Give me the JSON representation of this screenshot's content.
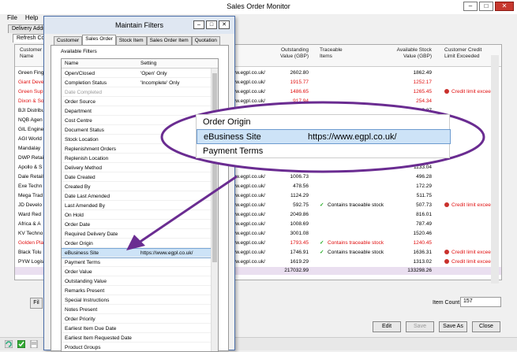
{
  "main": {
    "title": "Sales Order Monitor",
    "menu": [
      "File",
      "Help"
    ],
    "tabs": [
      "Delivery Addre"
    ],
    "subtab": "Refresh Cor",
    "columns": {
      "customer_name": "Customer\nName",
      "outstanding_value": "Outstanding\nValue (GBP)",
      "traceable_items": "Traceable\nItems",
      "available_stock_value": "Available Stock\nValue (GBP)",
      "customer_credit_limit": "Customer Credit\nLimit Exceeded"
    },
    "rows": [
      {
        "name": "Green Fing",
        "red": false,
        "site": "www.egpl.co.uk/",
        "outstanding": "2602.80",
        "traceable": "",
        "available": "1862.49",
        "credit": ""
      },
      {
        "name": "Giant Deve",
        "red": true,
        "site": "www.egpl.co.uk/",
        "outstanding": "1915.77",
        "traceable": "",
        "available": "1252.17",
        "credit": ""
      },
      {
        "name": "Green Sup",
        "red": true,
        "site": "www.egpl.co.uk/",
        "outstanding": "1486.65",
        "traceable": "",
        "available": "1265.45",
        "credit": "Credit limit exceede"
      },
      {
        "name": "Dixon & So",
        "red": true,
        "site": "www.egpl.co.uk/",
        "outstanding": "917.94",
        "traceable": "",
        "available": "254.34",
        "credit": ""
      },
      {
        "name": "BJI Distribu",
        "red": false,
        "site": "",
        "outstanding": "",
        "traceable": "",
        "available": "899.37",
        "credit": ""
      },
      {
        "name": "NQB Agen",
        "red": false,
        "site": "",
        "outstanding": "",
        "traceable": "",
        "available": "",
        "credit": ""
      },
      {
        "name": "GIL Engine",
        "red": false,
        "site": "",
        "outstanding": "",
        "traceable": "",
        "available": "",
        "credit": ""
      },
      {
        "name": "AGI World",
        "red": false,
        "site": "",
        "outstanding": "",
        "traceable": "",
        "available": "",
        "credit": ""
      },
      {
        "name": "Mandalay",
        "red": false,
        "site": "",
        "outstanding": "",
        "traceable": "",
        "available": "",
        "credit": ""
      },
      {
        "name": "DWP Retai",
        "red": false,
        "site": "",
        "outstanding": "",
        "traceable": "",
        "available": "",
        "credit": ""
      },
      {
        "name": "Apollo & S",
        "red": false,
        "site": "",
        "outstanding": "",
        "traceable": "",
        "available": "1133.04",
        "credit": ""
      },
      {
        "name": "Dale Retail",
        "red": false,
        "site": "www.egpl.co.uk/",
        "outstanding": "1006.73",
        "traceable": "",
        "available": "496.28",
        "credit": ""
      },
      {
        "name": "Exe Techn",
        "red": false,
        "site": "www.egpl.co.uk/",
        "outstanding": "478.56",
        "traceable": "",
        "available": "172.29",
        "credit": ""
      },
      {
        "name": "Mega Trad",
        "red": false,
        "site": "www.egpl.co.uk/",
        "outstanding": "1124.29",
        "traceable": "",
        "available": "511.75",
        "credit": ""
      },
      {
        "name": "JD Develo",
        "red": false,
        "site": "www.egpl.co.uk/",
        "outstanding": "592.75",
        "traceable": "Contains traceable stock",
        "available": "507.73",
        "credit": "Credit limit exceede"
      },
      {
        "name": "Ward Red",
        "red": false,
        "site": "www.egpl.co.uk/",
        "outstanding": "2049.86",
        "traceable": "",
        "available": "816.01",
        "credit": ""
      },
      {
        "name": "Africa & A",
        "red": false,
        "site": "www.egpl.co.uk/",
        "outstanding": "1008.69",
        "traceable": "",
        "available": "787.49",
        "credit": ""
      },
      {
        "name": "KV Techno",
        "red": false,
        "site": "www.egpl.co.uk/",
        "outstanding": "3001.08",
        "traceable": "",
        "available": "1520.46",
        "credit": ""
      },
      {
        "name": "Golden Pla",
        "red": true,
        "site": "www.egpl.co.uk/",
        "outstanding": "1793.45",
        "traceable": "Contains traceable stock",
        "available": "1240.45",
        "credit": ""
      },
      {
        "name": "Black Tolu",
        "red": false,
        "site": "www.egpl.co.uk/",
        "outstanding": "1746.91",
        "traceable": "Contains traceable stock",
        "available": "1636.31",
        "credit": "Credit limit exceede"
      },
      {
        "name": "PYW Logis",
        "red": false,
        "site": "www.egpl.co.uk/",
        "outstanding": "1619.29",
        "traceable": "",
        "available": "1313.02",
        "credit": "Credit limit exceede"
      }
    ],
    "totals": {
      "outstanding": "217032.99",
      "available": "133298.26"
    },
    "item_count_label": "Item Count",
    "item_count_value": "157",
    "filter_button": "Fil",
    "buttons": {
      "edit": "Edit",
      "save": "Save",
      "save_as": "Save As",
      "close": "Close"
    }
  },
  "dialog": {
    "title": "Maintain Filters",
    "tabs": [
      "Customer",
      "Sales Order",
      "Stock Item",
      "Sales Order Item",
      "Quotation"
    ],
    "active_tab": "Sales Order",
    "available_filters_label": "Available Filters",
    "col_name": "Name",
    "col_setting": "Setting",
    "filters": [
      {
        "name": "Open/Closed",
        "setting": "'Open' Only",
        "disabled": false
      },
      {
        "name": "Completion Status",
        "setting": "'Incomplete' Only",
        "disabled": false
      },
      {
        "name": "Date Completed",
        "setting": "",
        "disabled": true
      },
      {
        "name": "Order Source",
        "setting": "",
        "disabled": false
      },
      {
        "name": "Department",
        "setting": "",
        "disabled": false
      },
      {
        "name": "Cost Centre",
        "setting": "",
        "disabled": false
      },
      {
        "name": "Document Status",
        "setting": "",
        "disabled": false
      },
      {
        "name": "Stock Location",
        "setting": "",
        "disabled": false
      },
      {
        "name": "Replenishment Orders",
        "setting": "",
        "disabled": false
      },
      {
        "name": "Replenish Location",
        "setting": "",
        "disabled": false
      },
      {
        "name": "Delivery Method",
        "setting": "",
        "disabled": false
      },
      {
        "name": "Date Created",
        "setting": "",
        "disabled": false
      },
      {
        "name": "Created By",
        "setting": "",
        "disabled": false
      },
      {
        "name": "Date Last Amended",
        "setting": "",
        "disabled": false
      },
      {
        "name": "Last Amended By",
        "setting": "",
        "disabled": false
      },
      {
        "name": "On Hold",
        "setting": "",
        "disabled": false
      },
      {
        "name": "Order Date",
        "setting": "",
        "disabled": false
      },
      {
        "name": "Required Delivery Date",
        "setting": "",
        "disabled": false
      },
      {
        "name": "Order Origin",
        "setting": "",
        "disabled": false
      },
      {
        "name": "eBusiness Site",
        "setting": "https://www.egpl.co.uk/",
        "disabled": false,
        "selected": true
      },
      {
        "name": "Payment Terms",
        "setting": "",
        "disabled": false
      },
      {
        "name": "Order Value",
        "setting": "",
        "disabled": false
      },
      {
        "name": "Outstanding Value",
        "setting": "",
        "disabled": false
      },
      {
        "name": "Remarks Present",
        "setting": "",
        "disabled": false
      },
      {
        "name": "Special Instructions",
        "setting": "",
        "disabled": false
      },
      {
        "name": "Notes Present",
        "setting": "",
        "disabled": false
      },
      {
        "name": "Order Priority",
        "setting": "",
        "disabled": false
      },
      {
        "name": "Earliest Item Due Date",
        "setting": "",
        "disabled": false
      },
      {
        "name": "Earliest Item Requested Date",
        "setting": "",
        "disabled": false
      },
      {
        "name": "Product Groups",
        "setting": "",
        "disabled": false
      }
    ]
  },
  "zoom": {
    "rows": [
      {
        "name": "Order Origin",
        "value": ""
      },
      {
        "name": "eBusiness Site",
        "value": "https://www.egpl.co.uk/"
      },
      {
        "name": "Payment Terms",
        "value": ""
      }
    ],
    "callout_color": "#6a2c91"
  }
}
